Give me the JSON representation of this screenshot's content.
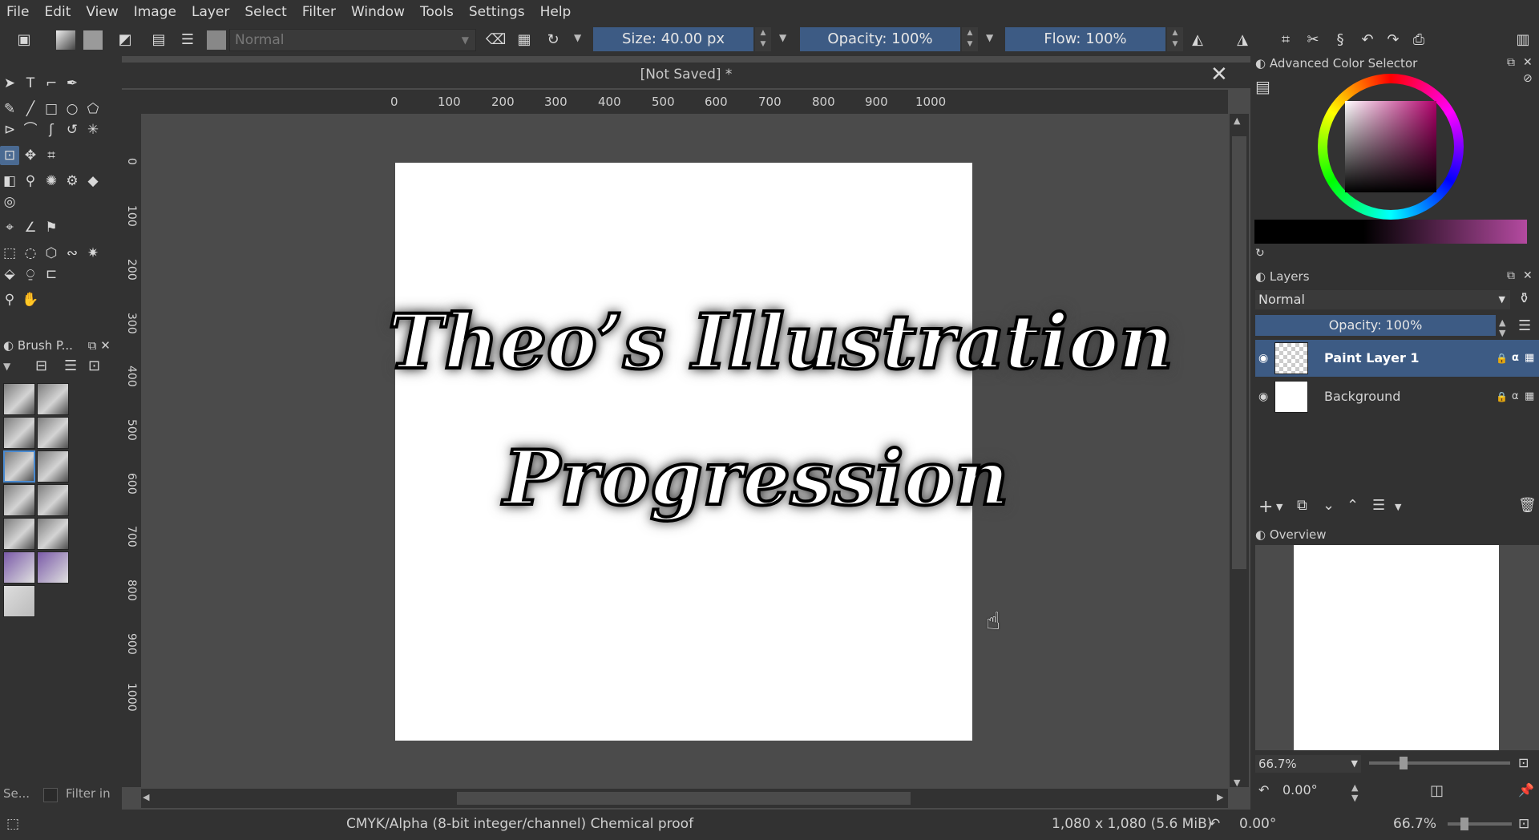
{
  "menu": [
    "File",
    "Edit",
    "View",
    "Image",
    "Layer",
    "Select",
    "Filter",
    "Window",
    "Tools",
    "Settings",
    "Help"
  ],
  "toolbar": {
    "blend_mode": "Normal",
    "size": "Size: 40.00 px",
    "opacity": "Opacity: 100%",
    "flow": "Flow: 100%"
  },
  "document": {
    "title": "[Not Saved]  *",
    "canvas_text_line1": "Theo’s Illustration",
    "canvas_text_line2": "Progression"
  },
  "ruler_h": [
    "0",
    "100",
    "200",
    "300",
    "400",
    "500",
    "600",
    "700",
    "800",
    "900",
    "1000"
  ],
  "ruler_v": [
    "0",
    "100",
    "200",
    "300",
    "400",
    "500",
    "600",
    "700",
    "800",
    "900",
    "1000"
  ],
  "brush_panel": {
    "title": "Brush P...",
    "search": "Se...",
    "filter": "Filter in"
  },
  "color_selector": {
    "title": "Advanced Color Selector"
  },
  "layers": {
    "title": "Layers",
    "blend": "Normal",
    "opacity": "Opacity:  100%",
    "items": [
      {
        "name": "Paint Layer 1",
        "selected": true
      },
      {
        "name": "Background",
        "selected": false
      }
    ]
  },
  "overview": {
    "title": "Overview",
    "zoom": "66.7%",
    "rotation": "0.00°"
  },
  "status": {
    "color_space": "CMYK/Alpha (8-bit integer/channel)  Chemical proof",
    "dimensions": "1,080 x 1,080 (5.6 MiB)",
    "rotation": "0.00°",
    "zoom": "66.7%"
  }
}
